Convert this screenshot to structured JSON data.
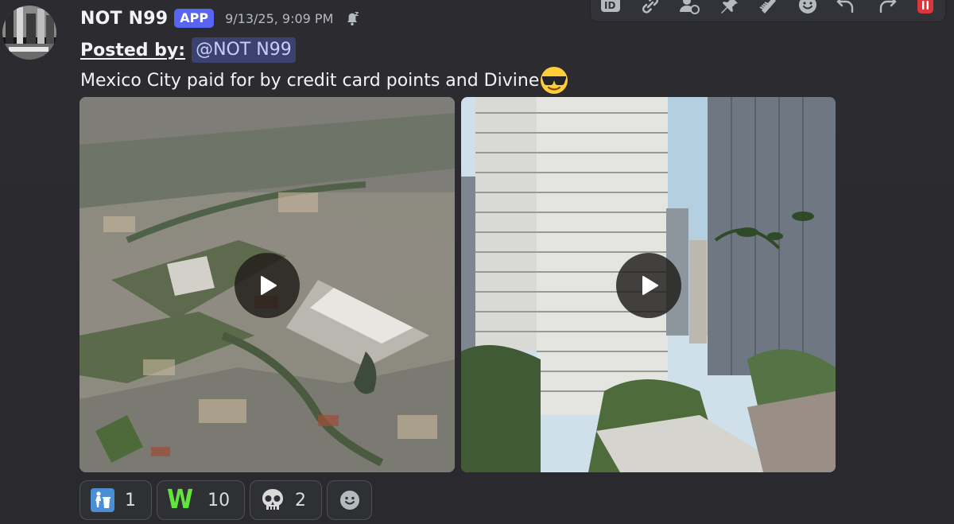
{
  "message": {
    "username": "NOT N99",
    "badge": "APP",
    "timestamp": "9/13/25, 9:09 PM",
    "posted_by_label": "Posted by:",
    "mention": "@NOT N99",
    "text": "Mexico City paid for by credit card points and Divine",
    "text_emoji": "smiling-face-with-sunglasses"
  },
  "toolbar": {
    "icons": [
      "id-icon",
      "link-icon",
      "user-refresh-icon",
      "pin-icon",
      "comb-icon",
      "add-reaction-icon",
      "reply-icon",
      "forward-icon",
      "delete-icon"
    ]
  },
  "attachments": [
    {
      "type": "video",
      "thumbnail": "aerial view of a dense city"
    },
    {
      "type": "video",
      "thumbnail": "tall residential towers"
    }
  ],
  "reactions": [
    {
      "icon": "trash-person-icon",
      "count": "1"
    },
    {
      "icon": "w-letter",
      "label": "W",
      "count": "10"
    },
    {
      "icon": "skull-icon",
      "count": "2"
    }
  ],
  "colors": {
    "background": "#2b2b2f",
    "badge": "#5865f2",
    "mention_bg": "#3c4270",
    "delete": "#da373c",
    "w_green": "#64e33c"
  }
}
